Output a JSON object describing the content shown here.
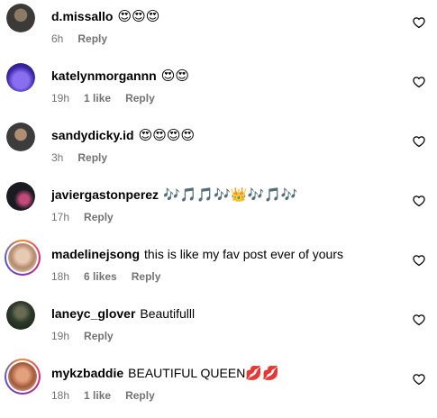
{
  "comments": [
    {
      "username": "d.missallo",
      "text": "",
      "emoji": "😍😍😍",
      "time": "6h",
      "likes": "",
      "reply": "Reply",
      "avatar_color": "#3b3a36",
      "ring": false
    },
    {
      "username": "katelynmorgannn",
      "text": "",
      "emoji": "😍😍",
      "time": "19h",
      "likes": "1 like",
      "reply": "Reply",
      "avatar_color": "#4b3bb8",
      "ring": false
    },
    {
      "username": "sandydicky.id",
      "text": "",
      "emoji": "😍😍😍😍",
      "time": "3h",
      "likes": "",
      "reply": "Reply",
      "avatar_color": "#3c3c3c",
      "ring": false
    },
    {
      "username": "javiergastonperez",
      "text": "",
      "emoji": "🎶🎵🎵🎶👑🎶🎵🎶",
      "time": "17h",
      "likes": "",
      "reply": "Reply",
      "avatar_color": "#1a1a22",
      "ring": false
    },
    {
      "username": "madelinejsong",
      "text": "this is like my fav post ever of yours",
      "emoji": "",
      "time": "18h",
      "likes": "6 likes",
      "reply": "Reply",
      "avatar_color": "#d9b79c",
      "ring": true
    },
    {
      "username": "laneyc_glover",
      "text": "Beautifulll",
      "emoji": "",
      "time": "19h",
      "likes": "",
      "reply": "Reply",
      "avatar_color": "#2d3a2a",
      "ring": false
    },
    {
      "username": "mykzbaddie",
      "text": "BEAUTIFUL QUEEN",
      "emoji": "💋💋",
      "time": "18h",
      "likes": "1 like",
      "reply": "Reply",
      "avatar_color": "#c97f5e",
      "ring": true
    }
  ],
  "icons": {
    "like": "heart-outline-icon"
  },
  "colors": {
    "meta": "#737373",
    "text": "#000000"
  }
}
